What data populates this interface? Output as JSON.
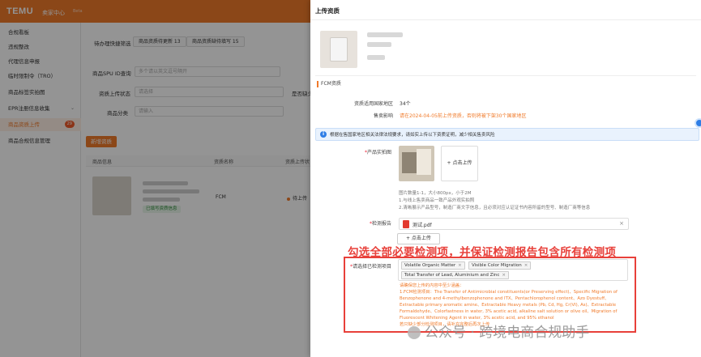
{
  "app": {
    "brand": "TEMU",
    "subtitle": "卖家中心",
    "tag": "Beta"
  },
  "sidebar": {
    "items": [
      {
        "label": "合规看板"
      },
      {
        "label": "违规整改"
      },
      {
        "label": "代理信息申报"
      },
      {
        "label": "临时限制令（TRO）"
      },
      {
        "label": "商品标签实拍图"
      },
      {
        "label": "EPR注册信息收集"
      },
      {
        "label": "商品资质上传",
        "badge": "29"
      },
      {
        "label": "商品合规信息管理"
      }
    ]
  },
  "main": {
    "tabs_label": "待办理快捷筛选",
    "pill1": "商品资质待更新 13",
    "pill2": "商品资质缺待填写 15",
    "spu_label": "商品SPU ID查询",
    "spu_placeholder": "多个请以英文逗号隔开",
    "upload_status_label": "资质上传状态",
    "upload_status_value": "请选择",
    "category_label": "商品分类",
    "category_value": "请输入",
    "more_label": "是否缺少",
    "new_button": "新增资质",
    "table": {
      "headers": [
        "商品信息",
        "资质名称",
        "资质上传状"
      ],
      "row": {
        "tag": "已填写资质信息",
        "qual_name": "FCM",
        "status": "待上传"
      }
    }
  },
  "drawer": {
    "title": "上传资质",
    "section": "FCM资质",
    "regions_label": "资质适用国家地区",
    "regions_value": "34个",
    "impact_label": "售卖影响",
    "impact_value": "请在2024-04-05前上传资质，否则将被下架30个国家地区",
    "info_text": "根据在售国家地区相关法律法规要求，请如实上传以下资质证明，减少相关售卖风险",
    "photo_label": "产品实拍图",
    "upload_label": "+ 点击上传",
    "hint1": "图片数量1-1，大小800px，小于2M",
    "hint2": "1.与线上售卖商品一致产品外观实拍照",
    "hint3": "2.清晰展示产品型号，制造厂商文字信息，且必须对应认证证书内容所留的型号、制造厂商等信息",
    "report_label": "检测报告",
    "file_name": "测试.pdf",
    "select_file": "+ 点击上传",
    "annotation": "勾选全部必要检测项，并保证检测报告包含所有检测项",
    "items_label": "请选择已检测项目",
    "tags": [
      "Volatile Organic Matter",
      "Visible Color Migration",
      "Total Transfer of Lead, Aluminium and Zinc"
    ],
    "warn1": "请确保您上传的内容中至少涵盖：",
    "warn2": "1.FCM检测项目：The Transfer of Antimicrobial constituents(or Preserving effect)、Specific Migration of",
    "warn3": "Benzophenone and 4-methylbenzophenone and ITX、Pentachlorophenol content、Azo Dyestuff、",
    "warn4": "Extractable primary aromatic amine、Extractable Heavy metals (Pb, Cd, Hg, Cr(VI), As)、Extractable",
    "warn5": "Formaldehyde、Colorfastness in water, 3% acetic acid, alkaline salt solution or olive oil、Migration of",
    "warn6": "Fluorescent Whitening Agent in water, 3% acetic acid, and 95% ethanol",
    "warn7": "若只缺少部分检测项目，请补充完整后再次上传"
  },
  "watermark": "公众号 · 跨境电商合规助手"
}
